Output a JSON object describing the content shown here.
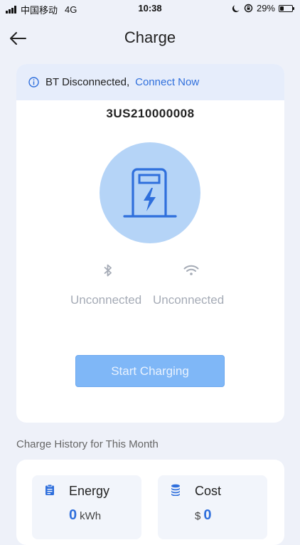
{
  "status_bar": {
    "carrier": "中国移动",
    "network": "4G",
    "time": "10:38",
    "battery": "29%",
    "battery_level": 0.29
  },
  "header": {
    "back_icon": "arrow-left-icon",
    "title": "Charge"
  },
  "banner": {
    "icon": "info-icon",
    "text": "BT Disconnected,",
    "link": "Connect Now"
  },
  "device": {
    "id": "3US210000008",
    "icon": "charging-station-icon"
  },
  "connections": {
    "bluetooth": {
      "icon": "bluetooth-icon",
      "label": "Unconnected"
    },
    "wifi": {
      "icon": "wifi-icon",
      "label": "Unconnected"
    }
  },
  "start_button": "Start Charging",
  "history": {
    "title": "Charge History for This Month",
    "energy": {
      "icon": "clipboard-icon",
      "label": "Energy",
      "value": "0",
      "unit": "kWh"
    },
    "cost": {
      "icon": "coin-stack-icon",
      "label": "Cost",
      "currency": "$",
      "value": "0"
    }
  },
  "colors": {
    "accent": "#2f6fdc",
    "button": "#7fb7f7",
    "circle": "#b5d4f7",
    "banner": "#e6edfb",
    "background": "#eef1f9"
  }
}
